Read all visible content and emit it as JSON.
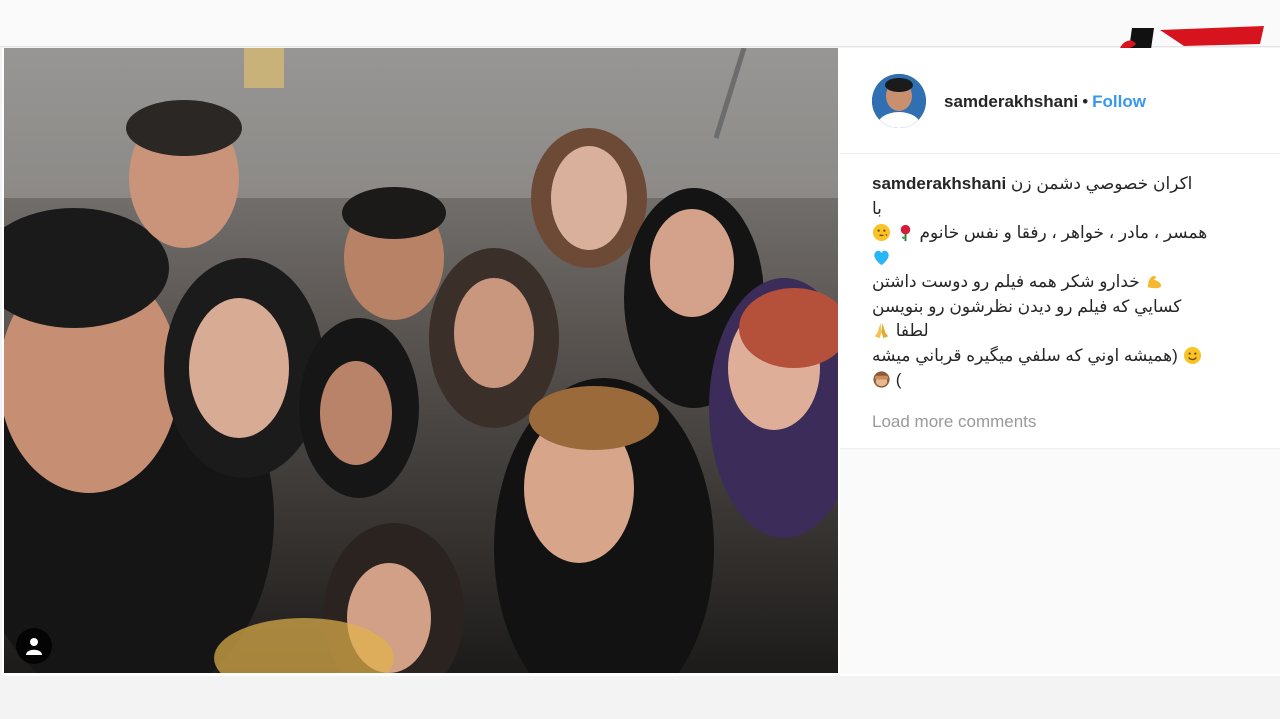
{
  "post": {
    "author": {
      "username": "samderakhshani",
      "separator": "•",
      "follow_label": "Follow"
    },
    "caption": {
      "username": "samderakhshani",
      "lines": [
        "اکران خصوصي دشمن زن",
        "با",
        "همسر ، مادر ، خواهر ، رفقا و نفس خانوم",
        "",
        "خدارو شکر همه فيلم رو دوست داشتن",
        "کسايي که فيلم رو ديدن نظرشون رو بنويسن",
        "لطفا",
        "(همیشه اوني که سلفي ميگيره قرباني ميشه",
        "("
      ],
      "emoji": [
        "kiss-emoji",
        "rose-emoji",
        "blue-heart-emoji",
        "flexed-biceps-emoji",
        "praying-hands-emoji",
        "smiling-face-emoji",
        "see-no-evil-monkey-emoji"
      ]
    },
    "load_more_label": "Load more comments",
    "photo": {
      "description_icon": "person-tag-icon"
    }
  },
  "brand": {
    "logo_icon": "rokna-logo",
    "colors": {
      "red": "#d7141d",
      "black": "#111111"
    }
  },
  "colors": {
    "link": "#3897f0",
    "text": "#262626",
    "muted": "#999999"
  }
}
